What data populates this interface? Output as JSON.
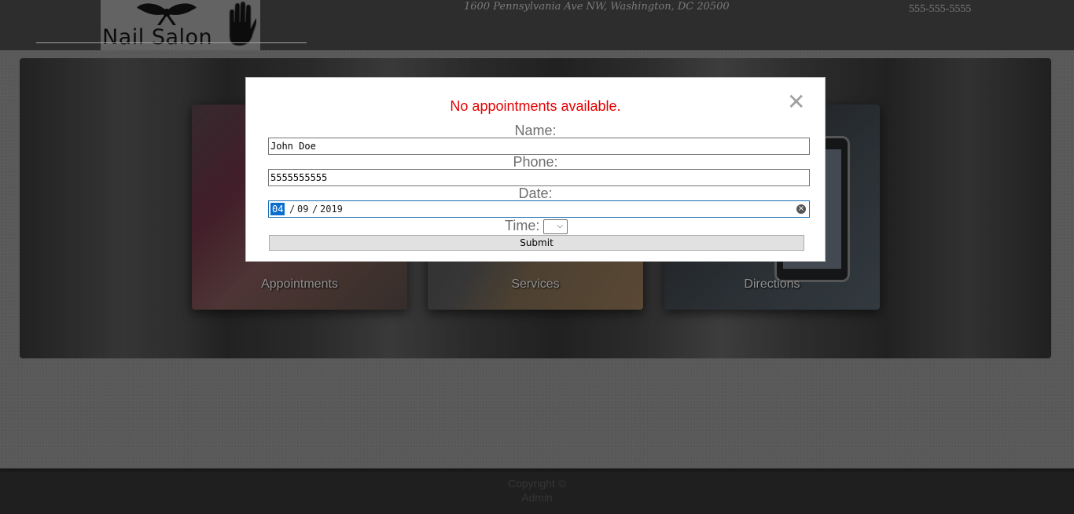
{
  "header": {
    "logo_text": "Nail Salon",
    "address": "1600 Pennsylvania Ave NW, Washington, DC 20500",
    "phone": "555-555-5555"
  },
  "cards": [
    {
      "label": "Appointments"
    },
    {
      "label": "Services"
    },
    {
      "label": "Directions"
    }
  ],
  "footer": {
    "line1": "Copyright ©",
    "line2": "Admin"
  },
  "modal": {
    "message": "No appointments available.",
    "close_glyph": "✕",
    "name_label": "Name:",
    "name_value": "John Doe",
    "phone_label": "Phone:",
    "phone_value": "5555555555",
    "date_label": "Date:",
    "date_month": "04",
    "date_day": "09",
    "date_year": "2019",
    "date_sep": "/",
    "time_label": "Time:",
    "time_value": "",
    "submit_label": "Submit"
  },
  "colors": {
    "message": "#e60000",
    "header_bg": "#3f3f3f",
    "date_focus": "#1a6fb5"
  },
  "icons": {
    "close": "close-icon",
    "date_clear": "clear-icon",
    "time_dropdown": "chevron-down-icon"
  }
}
